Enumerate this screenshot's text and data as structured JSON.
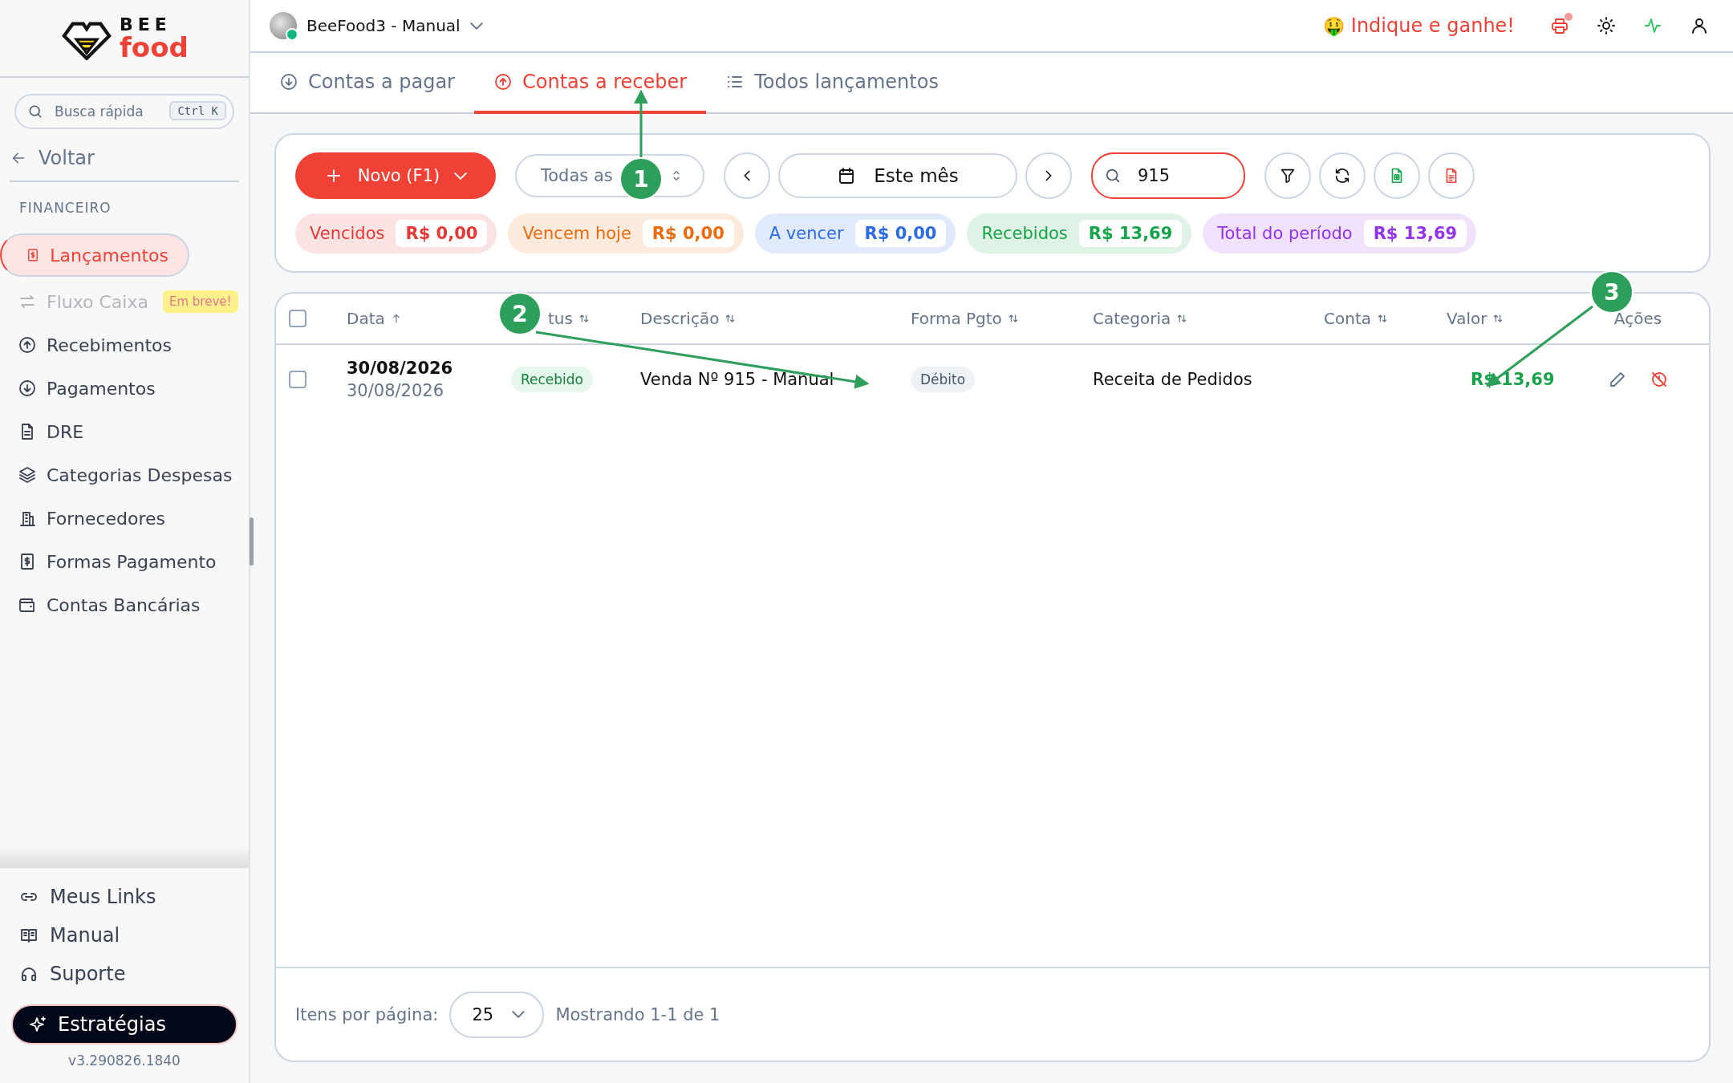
{
  "sidebar": {
    "logo": {
      "top": "BEE",
      "bottom": "food"
    },
    "search": {
      "placeholder": "Busca rápida",
      "shortcut": "Ctrl K"
    },
    "back": "Voltar",
    "section": "FINANCEIRO",
    "items": [
      {
        "label": "Lançamentos",
        "kind": "receipt",
        "selected": true,
        "disabled": false
      },
      {
        "label": "Fluxo Caixa",
        "kind": "arrows",
        "selected": false,
        "disabled": true,
        "badge": "Em breve!"
      },
      {
        "label": "Recebimentos",
        "kind": "up",
        "selected": false,
        "disabled": false
      },
      {
        "label": "Pagamentos",
        "kind": "down",
        "selected": false,
        "disabled": false
      },
      {
        "label": "DRE",
        "kind": "doc",
        "selected": false,
        "disabled": false
      },
      {
        "label": "Categorias Despesas",
        "kind": "layers",
        "selected": false,
        "disabled": false
      },
      {
        "label": "Fornecedores",
        "kind": "building",
        "selected": false,
        "disabled": false
      },
      {
        "label": "Formas Pagamento",
        "kind": "receipt",
        "selected": false,
        "disabled": false
      },
      {
        "label": "Contas Bancárias",
        "kind": "wallet",
        "selected": false,
        "disabled": false
      }
    ],
    "footer_links": [
      {
        "label": "Meus Links",
        "kind": "link"
      },
      {
        "label": "Manual",
        "kind": "book"
      },
      {
        "label": "Suporte",
        "kind": "headset"
      }
    ],
    "strategy_button": "Estratégias",
    "version": "v3.290826.1840"
  },
  "header": {
    "workspace": "BeeFood3 - Manual",
    "referral_emoji": "🤑",
    "referral": "Indique e ganhe!"
  },
  "tabs": [
    {
      "label": "Contas a pagar",
      "kind": "down",
      "selected": false
    },
    {
      "label": "Contas a receber",
      "kind": "up",
      "selected": true
    },
    {
      "label": "Todos lançamentos",
      "kind": "list",
      "selected": false
    }
  ],
  "toolbar": {
    "new_button": "Novo (F1)",
    "status_select": "Todas as",
    "period": "Este mês",
    "search_value": "915"
  },
  "summary": [
    {
      "label": "Vencidos",
      "value": "R$ 0,00",
      "color": "#e53935"
    },
    {
      "label": "Vencem hoje",
      "value": "R$ 0,00",
      "color": "#ea6a0c"
    },
    {
      "label": "A vencer",
      "value": "R$ 0,00",
      "color": "#2b6be6"
    },
    {
      "label": "Recebidos",
      "value": "R$ 13,69",
      "color": "#16a34a"
    },
    {
      "label": "Total do período",
      "value": "R$ 13,69",
      "color": "#9333ea"
    }
  ],
  "table": {
    "all_checked": false,
    "columns": [
      {
        "label": "Data",
        "sortable": true,
        "sorted_asc": true
      },
      {
        "label": "tus",
        "sortable": true,
        "sorted_asc": false
      },
      {
        "label": "Descrição",
        "sortable": true,
        "sorted_asc": false
      },
      {
        "label": "Forma Pgto",
        "sortable": true,
        "sorted_asc": false
      },
      {
        "label": "Categoria",
        "sortable": true,
        "sorted_asc": false
      },
      {
        "label": "Conta",
        "sortable": true,
        "sorted_asc": false
      },
      {
        "label": "Valor",
        "sortable": true,
        "sorted_asc": false
      },
      {
        "label": "Ações",
        "sortable": false
      }
    ],
    "rows": [
      {
        "checked": false,
        "date": "30/08/2026",
        "date_secondary": "30/08/2026",
        "status": "Recebido",
        "description": "Venda Nº 915 - Manual",
        "payment": "Débito",
        "category": "Receita de Pedidos",
        "value": "R$ 13,69"
      }
    ]
  },
  "pagination": {
    "label": "Itens por página:",
    "page_size": "25",
    "summary": "Mostrando 1-1 de 1"
  },
  "callouts": [
    "1",
    "2",
    "3"
  ]
}
